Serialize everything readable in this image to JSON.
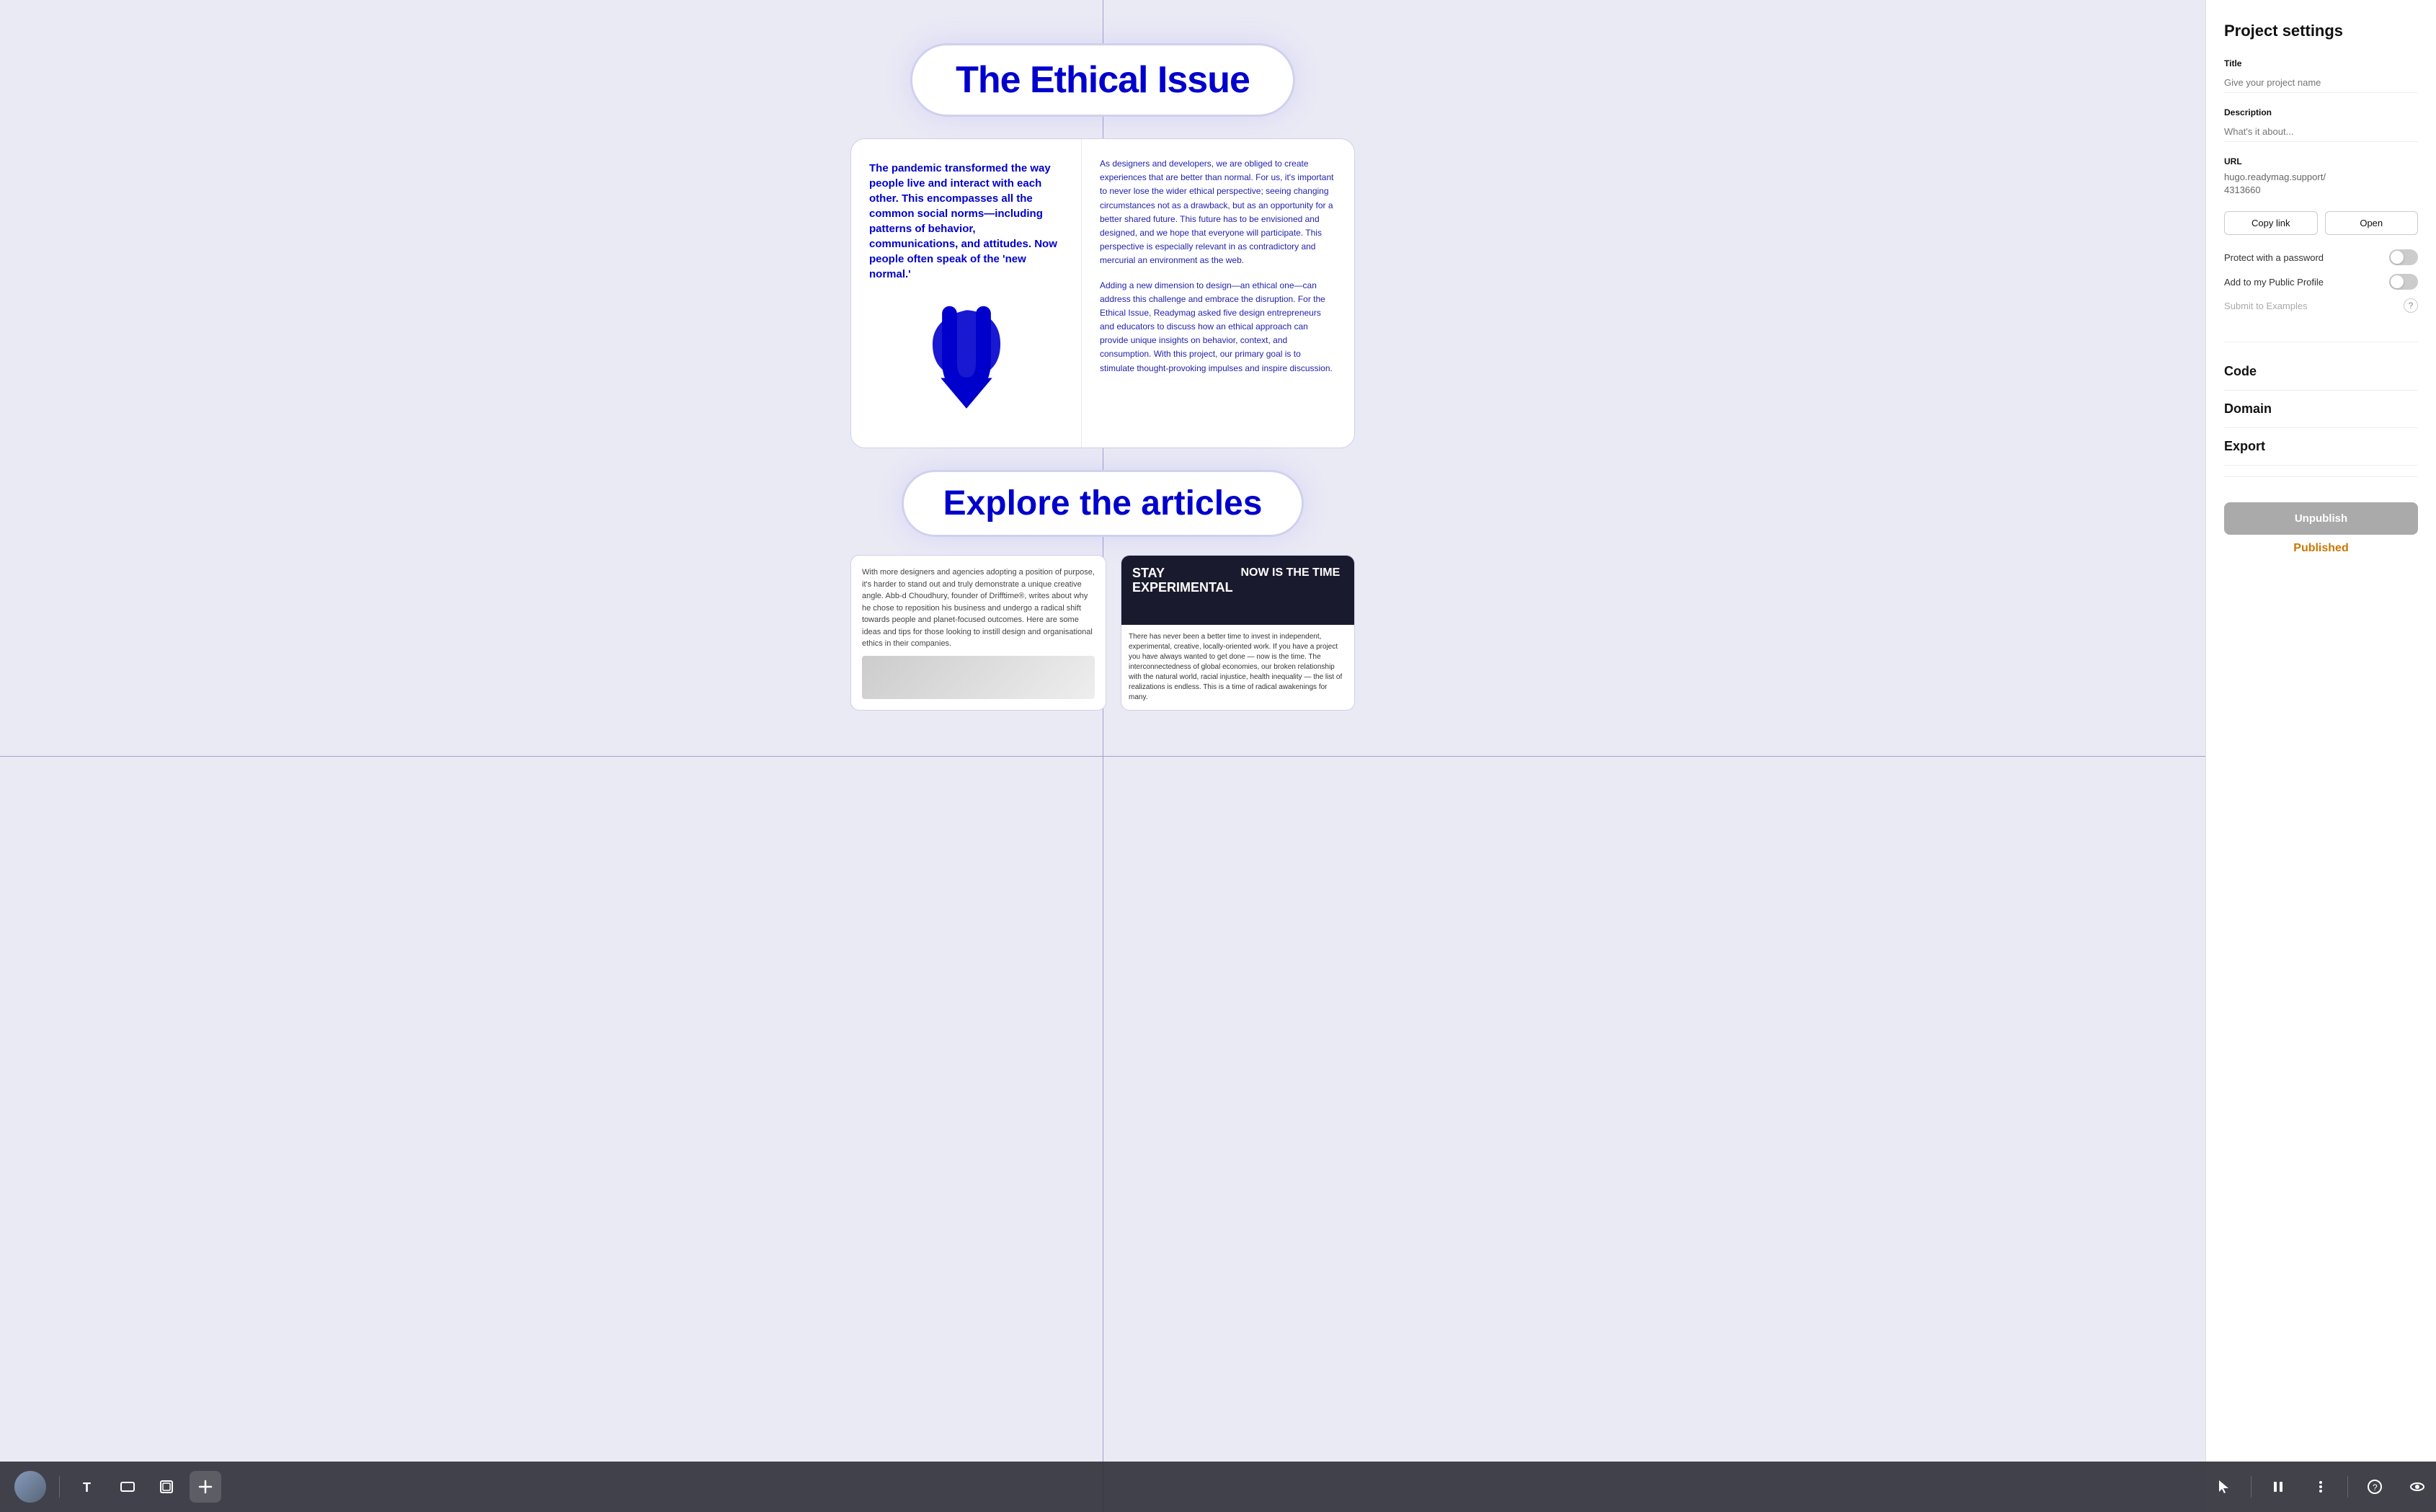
{
  "panel": {
    "title": "Project settings",
    "fields": {
      "title_label": "Title",
      "title_placeholder": "Give your project name",
      "description_label": "Description",
      "description_placeholder": "What's it about...",
      "url_label": "URL",
      "url_value": "hugo.readymag.support/\n4313660"
    },
    "buttons": {
      "copy_link": "Copy link",
      "open": "Open"
    },
    "toggles": {
      "password_label": "Protect with a password",
      "profile_label": "Add to my Public Profile"
    },
    "submit": {
      "label": "Submit to Examples"
    },
    "sections": {
      "code": "Code",
      "domain": "Domain",
      "export": "Export"
    },
    "actions": {
      "unpublish": "Unpublish",
      "published": "Published"
    }
  },
  "canvas": {
    "title": "The Ethical Issue",
    "explore_label": "Explore the articles",
    "card": {
      "left_text": "The pandemic transformed the way people live and interact with each other. This encompasses all the common social norms—including patterns of behavior, communications, and attitudes. Now people often speak of the 'new normal.'",
      "right_p1": "As designers and developers, we are obliged to create experiences that are better than normal. For us, it's important to never lose the wider ethical perspective; seeing changing circumstances not as a drawback, but as an opportunity for a better shared future. This future has to be envisioned and designed, and we hope that everyone will participate. This perspective is especially relevant in as contradictory and mercurial an environment as the web.",
      "right_p2": "Adding a new dimension to design—an ethical one—can address this challenge and embrace the disruption. For the Ethical Issue, Readymag asked five design entrepreneurs and educators to discuss how an ethical approach can provide unique insights on behavior, context, and consumption. With this project, our primary goal is to stimulate thought-provoking impulses and inspire discussion."
    },
    "articles": {
      "left_text": "With more designers and agencies adopting a position of purpose, it's harder to stand out and truly demonstrate a unique creative angle. Abb-d Choudhury, founder of Drifftime®, writes about why he chose to reposition his business and undergo a radical shift towards people and planet-focused outcomes. Here are some ideas and tips for those looking to instill design and organisational ethics in their companies.",
      "right_heading1": "STAY EXPERIMENTAL",
      "right_heading2": "NOW IS THE TIME",
      "right_body": "There has never been a better time to invest in independent, experimental, creative, locally-oriented work. If you have a project you have always wanted to get done — now is the time. The interconnectedness of global economies, our broken relationship with the natural world, racial injustice, health inequality — the list of realizations is endless. This is a time of radical awakenings for many."
    }
  },
  "toolbar": {
    "tools": [
      "T",
      "▭",
      "⊕",
      "+"
    ],
    "right_tools": [
      "↖",
      "⏸",
      "⌇",
      "?",
      "👁"
    ]
  }
}
